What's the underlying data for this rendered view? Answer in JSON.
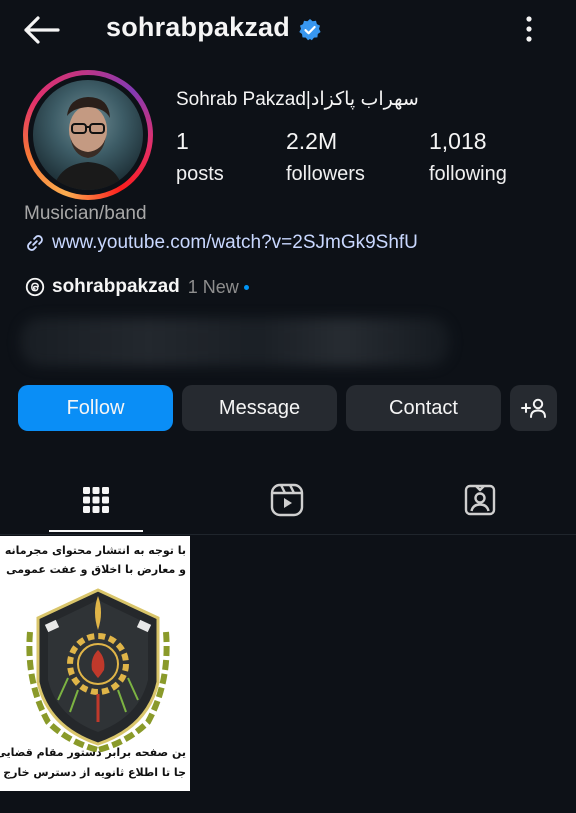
{
  "header": {
    "username": "sohrabpakzad",
    "back_icon": "back-arrow-icon",
    "verified_icon": "verified-badge-icon",
    "more_icon": "more-vertical-icon"
  },
  "profile": {
    "full_name": "Sohrab Pakzad|سهراب پاکزاد",
    "posts": {
      "count": "1",
      "label": "posts"
    },
    "followers": {
      "count": "2.2M",
      "label": "followers"
    },
    "following": {
      "count": "1,018",
      "label": "following"
    },
    "category": "Musician/band",
    "link": "www.youtube.com/watch?v=2SJmGk9ShfU",
    "threads_handle": "sohrabpakzad",
    "threads_badge": "1 New"
  },
  "actions": {
    "follow": "Follow",
    "message": "Message",
    "contact": "Contact"
  },
  "tabs": [
    {
      "name": "grid",
      "icon": "grid-icon",
      "active": true
    },
    {
      "name": "reels",
      "icon": "reels-icon",
      "active": false
    },
    {
      "name": "tagged",
      "icon": "tagged-icon",
      "active": false
    }
  ],
  "post": {
    "top_line_1": "با توجه به انتشار محتوای مجرمانه",
    "top_line_2": "و معارض با اخلاق و عفت عمومی",
    "bottom_line_1": "ین صفحه برابر دستور مقام قضایی توسط",
    "bottom_line_2": "جا تا اطلاع ثانویه از دسترس خارج گردید"
  },
  "colors": {
    "background": "#0d1117",
    "accent_blue": "#0a8ef6",
    "button_gray": "#262a30"
  }
}
